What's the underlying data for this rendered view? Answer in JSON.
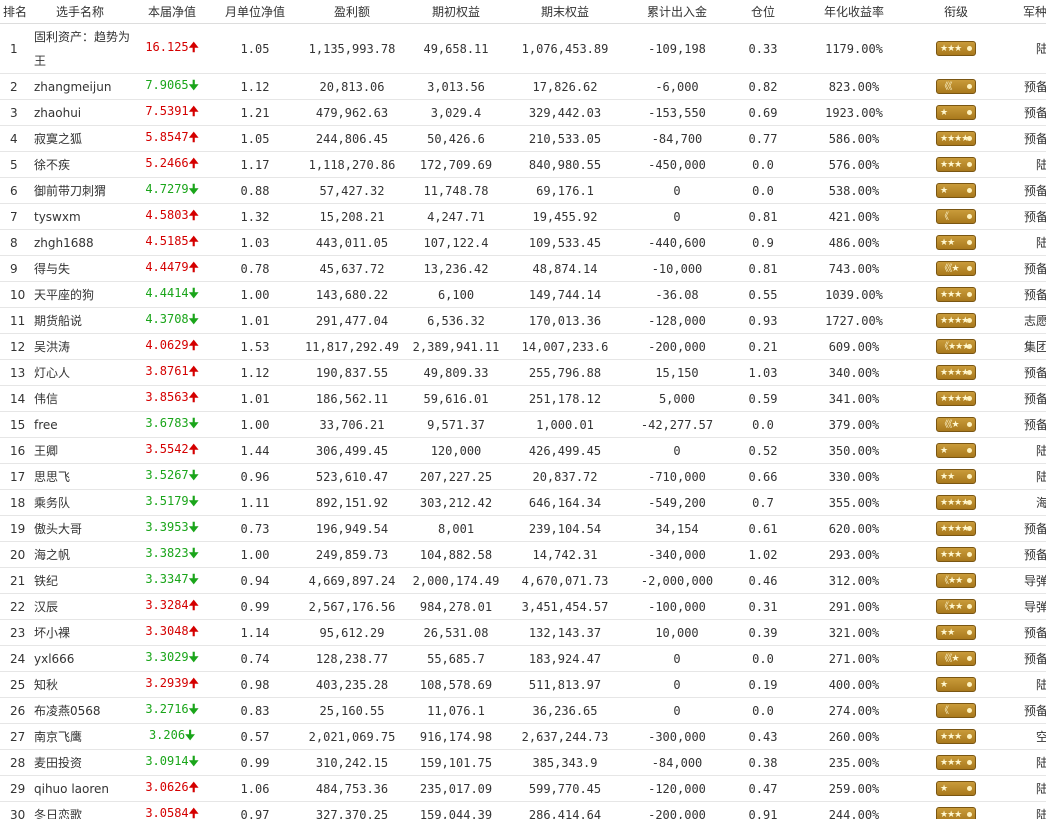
{
  "headers": [
    "排名",
    "选手名称",
    "本届净值",
    "月单位净值",
    "盈利额",
    "期初权益",
    "期末权益",
    "累计出入金",
    "仓位",
    "年化收益率",
    "衔级",
    "军种"
  ],
  "colors": {
    "up": "#d40000",
    "down": "#1aa51a",
    "badge": "#b88a2a"
  },
  "rows": [
    {
      "rank": "1",
      "name": "固利资产：趋势为王",
      "nav": "16.125",
      "dir": "up",
      "arrow": "🠉",
      "monthly": "1.05",
      "profit": "1,135,993.78",
      "begin": "49,658.11",
      "end": "1,076,453.89",
      "flow": "-109,198",
      "position": "0.33",
      "annual": "1179.00%",
      "insignia": "★★★",
      "branch": "陆军"
    },
    {
      "rank": "2",
      "name": "zhangmeijun",
      "nav": "7.9065",
      "dir": "down",
      "arrow": "🠋",
      "monthly": "1.12",
      "profit": "20,813.06",
      "begin": "3,013.56",
      "end": "17,826.62",
      "flow": "-6,000",
      "position": "0.82",
      "annual": "823.00%",
      "insignia": "《《",
      "branch": "预备役"
    },
    {
      "rank": "3",
      "name": "zhaohui",
      "nav": "7.5391",
      "dir": "up",
      "arrow": "🠉",
      "monthly": "1.21",
      "profit": "479,962.63",
      "begin": "3,029.4",
      "end": "329,442.03",
      "flow": "-153,550",
      "position": "0.69",
      "annual": "1923.00%",
      "insignia": "★",
      "branch": "预备役"
    },
    {
      "rank": "4",
      "name": "寂寞之狐",
      "nav": "5.8547",
      "dir": "up",
      "arrow": "🠉",
      "monthly": "1.05",
      "profit": "244,806.45",
      "begin": "50,426.6",
      "end": "210,533.05",
      "flow": "-84,700",
      "position": "0.77",
      "annual": "586.00%",
      "insignia": "★★★★",
      "branch": "预备役"
    },
    {
      "rank": "5",
      "name": "徐不疾",
      "nav": "5.2466",
      "dir": "up",
      "arrow": "🠉",
      "monthly": "1.17",
      "profit": "1,118,270.86",
      "begin": "172,709.69",
      "end": "840,980.55",
      "flow": "-450,000",
      "position": "0.0",
      "annual": "576.00%",
      "insignia": "★★★",
      "branch": "陆军"
    },
    {
      "rank": "6",
      "name": "御前带刀刺猬",
      "nav": "4.7279",
      "dir": "down",
      "arrow": "🠋",
      "monthly": "0.88",
      "profit": "57,427.32",
      "begin": "11,748.78",
      "end": "69,176.1",
      "flow": "0",
      "position": "0.0",
      "annual": "538.00%",
      "insignia": "★",
      "branch": "预备役"
    },
    {
      "rank": "7",
      "name": "tyswxm",
      "nav": "4.5803",
      "dir": "up",
      "arrow": "🠉",
      "monthly": "1.32",
      "profit": "15,208.21",
      "begin": "4,247.71",
      "end": "19,455.92",
      "flow": "0",
      "position": "0.81",
      "annual": "421.00%",
      "insignia": "《",
      "branch": "预备役"
    },
    {
      "rank": "8",
      "name": "zhgh1688",
      "nav": "4.5185",
      "dir": "up",
      "arrow": "🠉",
      "monthly": "1.03",
      "profit": "443,011.05",
      "begin": "107,122.4",
      "end": "109,533.45",
      "flow": "-440,600",
      "position": "0.9",
      "annual": "486.00%",
      "insignia": "★★",
      "branch": "陆军"
    },
    {
      "rank": "9",
      "name": "得与失",
      "nav": "4.4479",
      "dir": "up",
      "arrow": "🠉",
      "monthly": "0.78",
      "profit": "45,637.72",
      "begin": "13,236.42",
      "end": "48,874.14",
      "flow": "-10,000",
      "position": "0.81",
      "annual": "743.00%",
      "insignia": "《《★",
      "branch": "预备役"
    },
    {
      "rank": "10",
      "name": "天平座的狗",
      "nav": "4.4414",
      "dir": "down",
      "arrow": "🠋",
      "monthly": "1.00",
      "profit": "143,680.22",
      "begin": "6,100",
      "end": "149,744.14",
      "flow": "-36.08",
      "position": "0.55",
      "annual": "1039.00%",
      "insignia": "★★★",
      "branch": "预备役"
    },
    {
      "rank": "11",
      "name": "期货船说",
      "nav": "4.3708",
      "dir": "down",
      "arrow": "🠋",
      "monthly": "1.01",
      "profit": "291,477.04",
      "begin": "6,536.32",
      "end": "170,013.36",
      "flow": "-128,000",
      "position": "0.93",
      "annual": "1727.00%",
      "insignia": "★★★★",
      "branch": "志愿军"
    },
    {
      "rank": "12",
      "name": "吴洪涛",
      "nav": "4.0629",
      "dir": "up",
      "arrow": "🠉",
      "monthly": "1.53",
      "profit": "11,817,292.49",
      "begin": "2,389,941.11",
      "end": "14,007,233.6",
      "flow": "-200,000",
      "position": "0.21",
      "annual": "609.00%",
      "insignia": "《★★★",
      "branch": "集团军"
    },
    {
      "rank": "13",
      "name": "灯心人",
      "nav": "3.8761",
      "dir": "up",
      "arrow": "🠉",
      "monthly": "1.12",
      "profit": "190,837.55",
      "begin": "49,809.33",
      "end": "255,796.88",
      "flow": "15,150",
      "position": "1.03",
      "annual": "340.00%",
      "insignia": "★★★★",
      "branch": "预备役"
    },
    {
      "rank": "14",
      "name": "伟信",
      "nav": "3.8563",
      "dir": "up",
      "arrow": "🠉",
      "monthly": "1.01",
      "profit": "186,562.11",
      "begin": "59,616.01",
      "end": "251,178.12",
      "flow": "5,000",
      "position": "0.59",
      "annual": "341.00%",
      "insignia": "★★★★",
      "branch": "预备役"
    },
    {
      "rank": "15",
      "name": "free",
      "nav": "3.6783",
      "dir": "down",
      "arrow": "🠋",
      "monthly": "1.00",
      "profit": "33,706.21",
      "begin": "9,571.37",
      "end": "1,000.01",
      "flow": "-42,277.57",
      "position": "0.0",
      "annual": "379.00%",
      "insignia": "《《★",
      "branch": "预备役"
    },
    {
      "rank": "16",
      "name": "王卿",
      "nav": "3.5542",
      "dir": "up",
      "arrow": "🠉",
      "monthly": "1.44",
      "profit": "306,499.45",
      "begin": "120,000",
      "end": "426,499.45",
      "flow": "0",
      "position": "0.52",
      "annual": "350.00%",
      "insignia": "★",
      "branch": "陆军"
    },
    {
      "rank": "17",
      "name": "思思飞",
      "nav": "3.5267",
      "dir": "down",
      "arrow": "🠋",
      "monthly": "0.96",
      "profit": "523,610.47",
      "begin": "207,227.25",
      "end": "20,837.72",
      "flow": "-710,000",
      "position": "0.66",
      "annual": "330.00%",
      "insignia": "★★",
      "branch": "陆军"
    },
    {
      "rank": "18",
      "name": "乘务队",
      "nav": "3.5179",
      "dir": "down",
      "arrow": "🠋",
      "monthly": "1.11",
      "profit": "892,151.92",
      "begin": "303,212.42",
      "end": "646,164.34",
      "flow": "-549,200",
      "position": "0.7",
      "annual": "355.00%",
      "insignia": "★★★★",
      "branch": "海军"
    },
    {
      "rank": "19",
      "name": "傲头大哥",
      "nav": "3.3953",
      "dir": "down",
      "arrow": "🠋",
      "monthly": "0.73",
      "profit": "196,949.54",
      "begin": "8,001",
      "end": "239,104.54",
      "flow": "34,154",
      "position": "0.61",
      "annual": "620.00%",
      "insignia": "★★★★",
      "branch": "预备役"
    },
    {
      "rank": "20",
      "name": "海之帆",
      "nav": "3.3823",
      "dir": "down",
      "arrow": "🠋",
      "monthly": "1.00",
      "profit": "249,859.73",
      "begin": "104,882.58",
      "end": "14,742.31",
      "flow": "-340,000",
      "position": "1.02",
      "annual": "293.00%",
      "insignia": "★★★",
      "branch": "预备役"
    },
    {
      "rank": "21",
      "name": "铁纪",
      "nav": "3.3347",
      "dir": "down",
      "arrow": "🠋",
      "monthly": "0.94",
      "profit": "4,669,897.24",
      "begin": "2,000,174.49",
      "end": "4,670,071.73",
      "flow": "-2,000,000",
      "position": "0.46",
      "annual": "312.00%",
      "insignia": "《★★",
      "branch": "导弹部"
    },
    {
      "rank": "22",
      "name": "汉辰",
      "nav": "3.3284",
      "dir": "up",
      "arrow": "🠉",
      "monthly": "0.99",
      "profit": "2,567,176.56",
      "begin": "984,278.01",
      "end": "3,451,454.57",
      "flow": "-100,000",
      "position": "0.31",
      "annual": "291.00%",
      "insignia": "《★★",
      "branch": "导弹部"
    },
    {
      "rank": "23",
      "name": "坏小裸",
      "nav": "3.3048",
      "dir": "up",
      "arrow": "🠉",
      "monthly": "1.14",
      "profit": "95,612.29",
      "begin": "26,531.08",
      "end": "132,143.37",
      "flow": "10,000",
      "position": "0.39",
      "annual": "321.00%",
      "insignia": "★★",
      "branch": "预备役"
    },
    {
      "rank": "24",
      "name": "yxl666",
      "nav": "3.3029",
      "dir": "down",
      "arrow": "🠋",
      "monthly": "0.74",
      "profit": "128,238.77",
      "begin": "55,685.7",
      "end": "183,924.47",
      "flow": "0",
      "position": "0.0",
      "annual": "271.00%",
      "insignia": "《《★",
      "branch": "预备役"
    },
    {
      "rank": "25",
      "name": "知秋",
      "nav": "3.2939",
      "dir": "up",
      "arrow": "🠉",
      "monthly": "0.98",
      "profit": "403,235.28",
      "begin": "108,578.69",
      "end": "511,813.97",
      "flow": "0",
      "position": "0.19",
      "annual": "400.00%",
      "insignia": "★",
      "branch": "陆军"
    },
    {
      "rank": "26",
      "name": "布凌燕0568",
      "nav": "3.2716",
      "dir": "down",
      "arrow": "🠋",
      "monthly": "0.83",
      "profit": "25,160.55",
      "begin": "11,076.1",
      "end": "36,236.65",
      "flow": "0",
      "position": "0.0",
      "annual": "274.00%",
      "insignia": "《",
      "branch": "预备役"
    },
    {
      "rank": "27",
      "name": "南京飞鹰",
      "nav": "3.206",
      "dir": "down",
      "arrow": "🠋",
      "monthly": "0.57",
      "profit": "2,021,069.75",
      "begin": "916,174.98",
      "end": "2,637,244.73",
      "flow": "-300,000",
      "position": "0.43",
      "annual": "260.00%",
      "insignia": "★★★",
      "branch": "空军"
    },
    {
      "rank": "28",
      "name": "麦田投资",
      "nav": "3.0914",
      "dir": "down",
      "arrow": "🠋",
      "monthly": "0.99",
      "profit": "310,242.15",
      "begin": "159,101.75",
      "end": "385,343.9",
      "flow": "-84,000",
      "position": "0.38",
      "annual": "235.00%",
      "insignia": "★★★",
      "branch": "陆军"
    },
    {
      "rank": "29",
      "name": "qihuo laoren",
      "nav": "3.0626",
      "dir": "up",
      "arrow": "🠉",
      "monthly": "1.06",
      "profit": "484,753.36",
      "begin": "235,017.09",
      "end": "599,770.45",
      "flow": "-120,000",
      "position": "0.47",
      "annual": "259.00%",
      "insignia": "★",
      "branch": "陆军"
    },
    {
      "rank": "30",
      "name": "冬日恋歌",
      "nav": "3.0584",
      "dir": "up",
      "arrow": "🠉",
      "monthly": "0.97",
      "profit": "327,370.25",
      "begin": "159,044.39",
      "end": "286,414.64",
      "flow": "-200,000",
      "position": "0.91",
      "annual": "244.00%",
      "insignia": "★★★",
      "branch": "陆军"
    }
  ]
}
